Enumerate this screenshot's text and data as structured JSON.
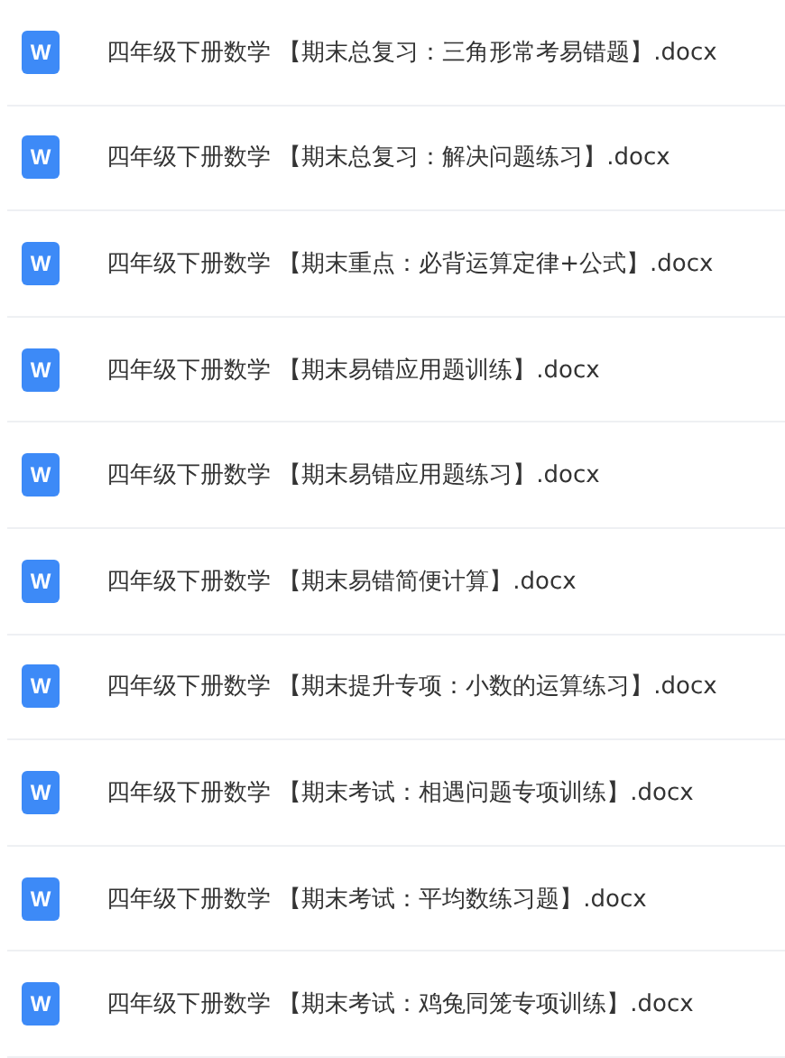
{
  "files": [
    {
      "badge": "W",
      "name": "四年级下册数学 【期末总复习：三角形常考易错题】.docx"
    },
    {
      "badge": "W",
      "name": "四年级下册数学 【期末总复习：解决问题练习】.docx"
    },
    {
      "badge": "W",
      "name": "四年级下册数学 【期末重点：必背运算定律+公式】.docx"
    },
    {
      "badge": "W",
      "name": "四年级下册数学 【期末易错应用题训练】.docx"
    },
    {
      "badge": "W",
      "name": "四年级下册数学 【期末易错应用题练习】.docx"
    },
    {
      "badge": "W",
      "name": "四年级下册数学 【期末易错简便计算】.docx"
    },
    {
      "badge": "W",
      "name": "四年级下册数学 【期末提升专项：小数的运算练习】.docx"
    },
    {
      "badge": "W",
      "name": "四年级下册数学 【期末考试：相遇问题专项训练】.docx"
    },
    {
      "badge": "W",
      "name": "四年级下册数学 【期末考试：平均数练习题】.docx"
    },
    {
      "badge": "W",
      "name": "四年级下册数学 【期末考试：鸡兔同笼专项训练】.docx"
    }
  ]
}
